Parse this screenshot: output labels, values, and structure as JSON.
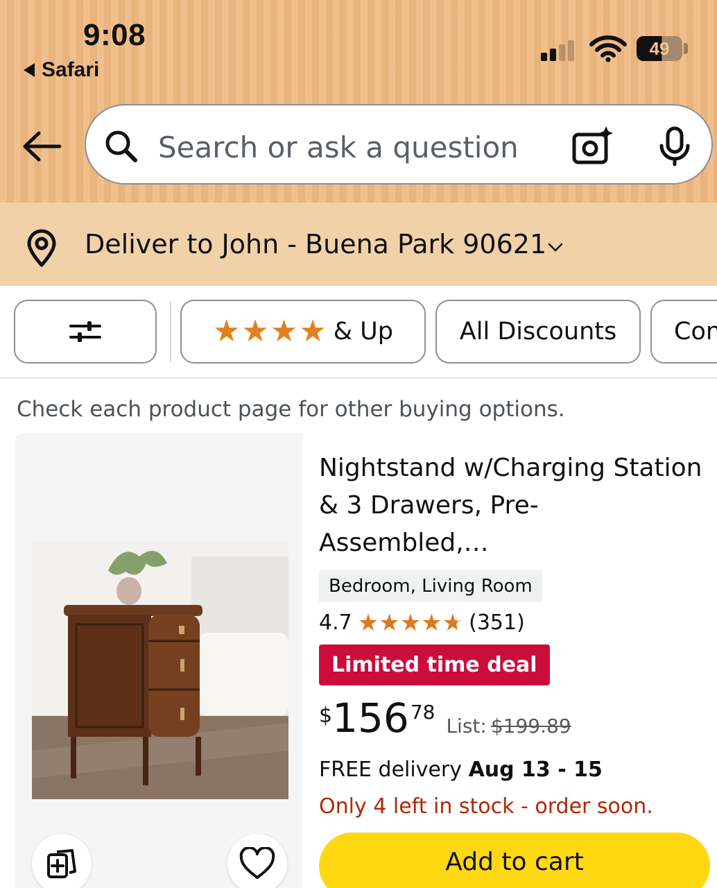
{
  "status_bar": {
    "time": "9:08",
    "back_app": "Safari",
    "battery": "49"
  },
  "header": {
    "search_placeholder": "Search or ask a question",
    "icons": [
      "back-arrow-icon",
      "search-icon",
      "camera-icon",
      "mic-icon"
    ]
  },
  "delivery": {
    "text": "Deliver to John - Buena Park 90621"
  },
  "filters": {
    "stars_suffix": "& Up",
    "discounts_label": "All Discounts",
    "partial_label": "Con"
  },
  "results": {
    "info": "Check each product page for other buying options."
  },
  "product": {
    "title_line1": "Nightstand w/Charging Station",
    "title_line2": "& 3 Drawers, Pre-Assembled,…",
    "tag": "Bedroom, Living Room",
    "rating": "4.7",
    "rating_stars_value": 4.7,
    "review_count": "(351)",
    "deal_badge": "Limited time deal",
    "price_symbol": "$",
    "price_whole": "156",
    "price_fraction": "78",
    "list_label": "List:",
    "list_price": "$199.89",
    "delivery_prefix": "FREE delivery",
    "delivery_dates": "Aug 13 - 15",
    "stock": "Only 4 left in stock - order soon.",
    "add_to_cart": "Add to cart"
  },
  "colors": {
    "header_bg": "#eeb87f",
    "delivery_bg": "#f1d2a8",
    "star": "#de7921",
    "deal": "#cc0c39",
    "stock": "#b12704",
    "cart": "#ffd814"
  }
}
